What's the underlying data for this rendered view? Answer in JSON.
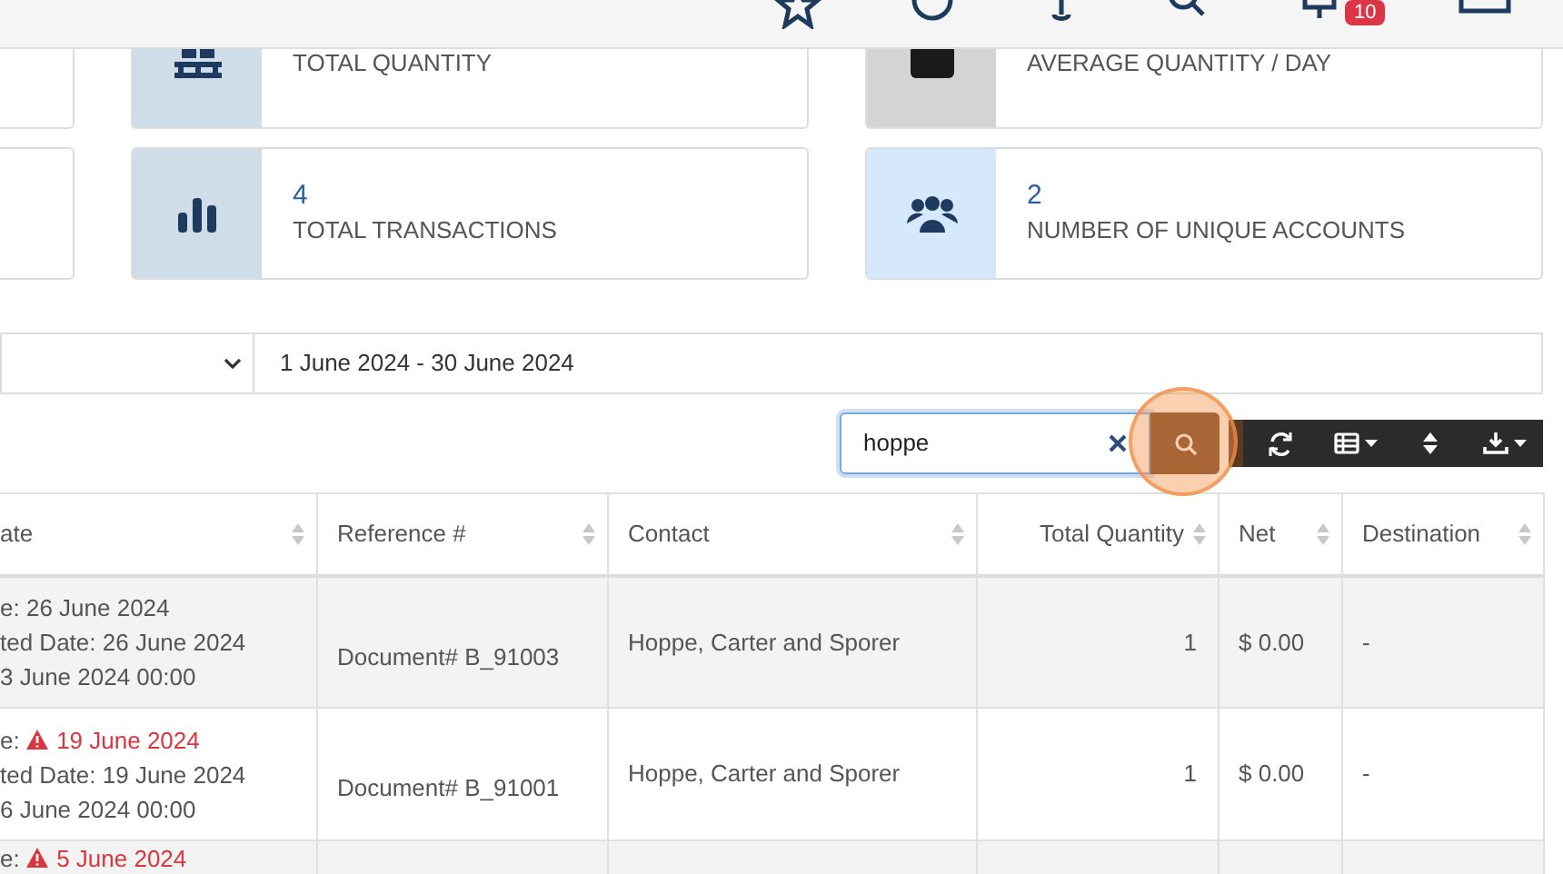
{
  "top_bar": {
    "notification_badge": "10"
  },
  "stat_cards": [
    {
      "kind": "pallet",
      "color": "#cfdde8",
      "label": "TOTAL QUANTITY"
    },
    {
      "kind": "square",
      "color": "#d4d4d4",
      "label": "AVERAGE QUANTITY / DAY"
    },
    {
      "kind": "bars",
      "color": "#cfdde8",
      "value": "4",
      "label": "TOTAL TRANSACTIONS"
    },
    {
      "kind": "users",
      "color": "#d6e8fb",
      "value": "2",
      "label": "NUMBER OF UNIQUE ACCOUNTS"
    }
  ],
  "filters": {
    "date_range": "1 June 2024 - 30 June 2024"
  },
  "search": {
    "value": "hoppe"
  },
  "toolbar_buttons": [
    {
      "kind": "refresh",
      "caret": false
    },
    {
      "kind": "table",
      "caret": true
    },
    {
      "kind": "sort",
      "caret": false
    },
    {
      "kind": "download",
      "caret": true
    }
  ],
  "table": {
    "columns": [
      {
        "label": "ate"
      },
      {
        "label": "Reference #"
      },
      {
        "label": "Contact"
      },
      {
        "label": "Total Quantity"
      },
      {
        "label": "Net"
      },
      {
        "label": "Destination"
      }
    ],
    "rows": [
      {
        "due": {
          "label": "e:",
          "date": "26 June 2024",
          "overdue": false
        },
        "line_2": "ted Date: 26 June 2024",
        "line_3": "3 June 2024 00:00",
        "reference": "Document# B_91003",
        "contact": "Hoppe, Carter and Sporer",
        "total_quantity": "1",
        "net": "$ 0.00",
        "destination": "-"
      },
      {
        "due": {
          "label": "e:",
          "date": "19 June 2024",
          "overdue": true
        },
        "line_2": "ted Date: 19 June 2024",
        "line_3": "6 June 2024 00:00",
        "reference": "Document# B_91001",
        "contact": "Hoppe, Carter and Sporer",
        "total_quantity": "1",
        "net": "$ 0.00",
        "destination": "-"
      },
      {
        "due": {
          "label": "e:",
          "date": "5 June 2024",
          "overdue": true
        }
      }
    ]
  }
}
